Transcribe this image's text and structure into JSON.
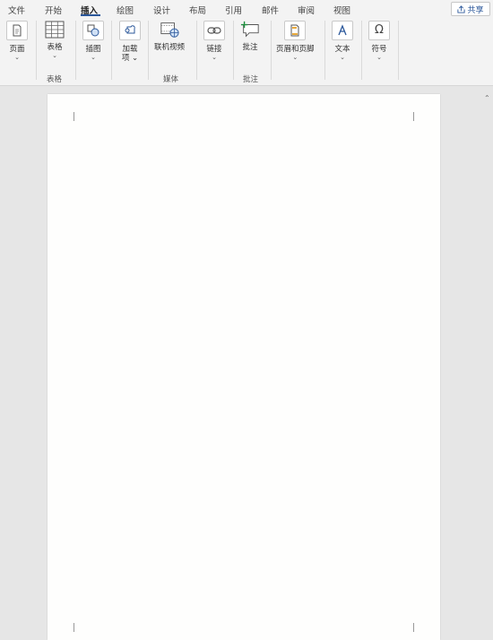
{
  "menu": {
    "tabs": [
      "文件",
      "开始",
      "插入",
      "绘图",
      "设计",
      "布局",
      "引用",
      "邮件",
      "审阅",
      "视图"
    ],
    "active_tab": "插入",
    "share_label": "共享"
  },
  "ribbon": {
    "buttons": {
      "page": "页面",
      "table": "表格",
      "illustration": "插图",
      "addins_line1": "加载",
      "addins_line2": "项",
      "online_video": "联机视频",
      "link": "链接",
      "comment": "批注",
      "header_footer": "页眉和页脚",
      "text": "文本",
      "symbol": "符号"
    },
    "groups": {
      "tables": "表格",
      "media": "媒体",
      "comments": "批注"
    }
  },
  "colors": {
    "accent": "#2b579a",
    "ribbon_bg": "#f3f3f3",
    "workspace_bg": "#e6e6e6",
    "page_bg": "#fefefd"
  }
}
